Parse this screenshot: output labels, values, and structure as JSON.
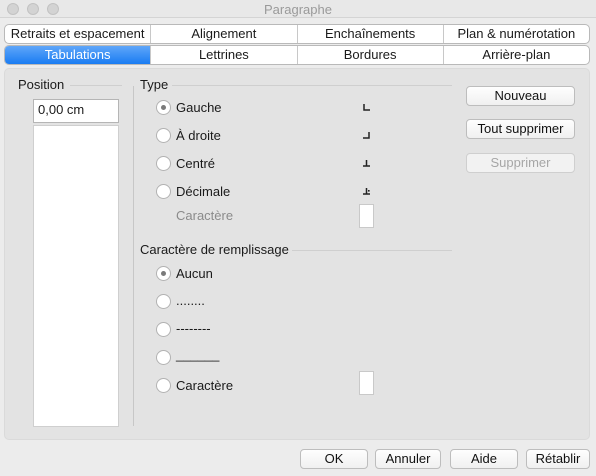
{
  "window": {
    "title": "Paragraphe"
  },
  "tabs": {
    "row1": [
      "Retraits et espacement",
      "Alignement",
      "Enchaînements",
      "Plan & numérotation"
    ],
    "row2": [
      "Tabulations",
      "Lettrines",
      "Bordures",
      "Arrière-plan"
    ],
    "active": "Tabulations"
  },
  "position": {
    "label": "Position",
    "value": "0,00 cm"
  },
  "type": {
    "label": "Type",
    "options": [
      "Gauche",
      "À droite",
      "Centré",
      "Décimale"
    ],
    "selected": "Gauche",
    "character_label": "Caractère"
  },
  "fill": {
    "label": "Caractère de remplissage",
    "options": [
      "Aucun",
      "........",
      "--------",
      "______",
      "Caractère"
    ],
    "selected": "Aucun"
  },
  "side_buttons": {
    "new": "Nouveau",
    "delete_all": "Tout supprimer",
    "delete": "Supprimer"
  },
  "bottom_buttons": {
    "ok": "OK",
    "cancel": "Annuler",
    "help": "Aide",
    "reset": "Rétablir"
  },
  "colors": {
    "active_tab": "#1a7cf2",
    "window_bg": "#ececec",
    "panel_bg": "#e3e3e3"
  }
}
